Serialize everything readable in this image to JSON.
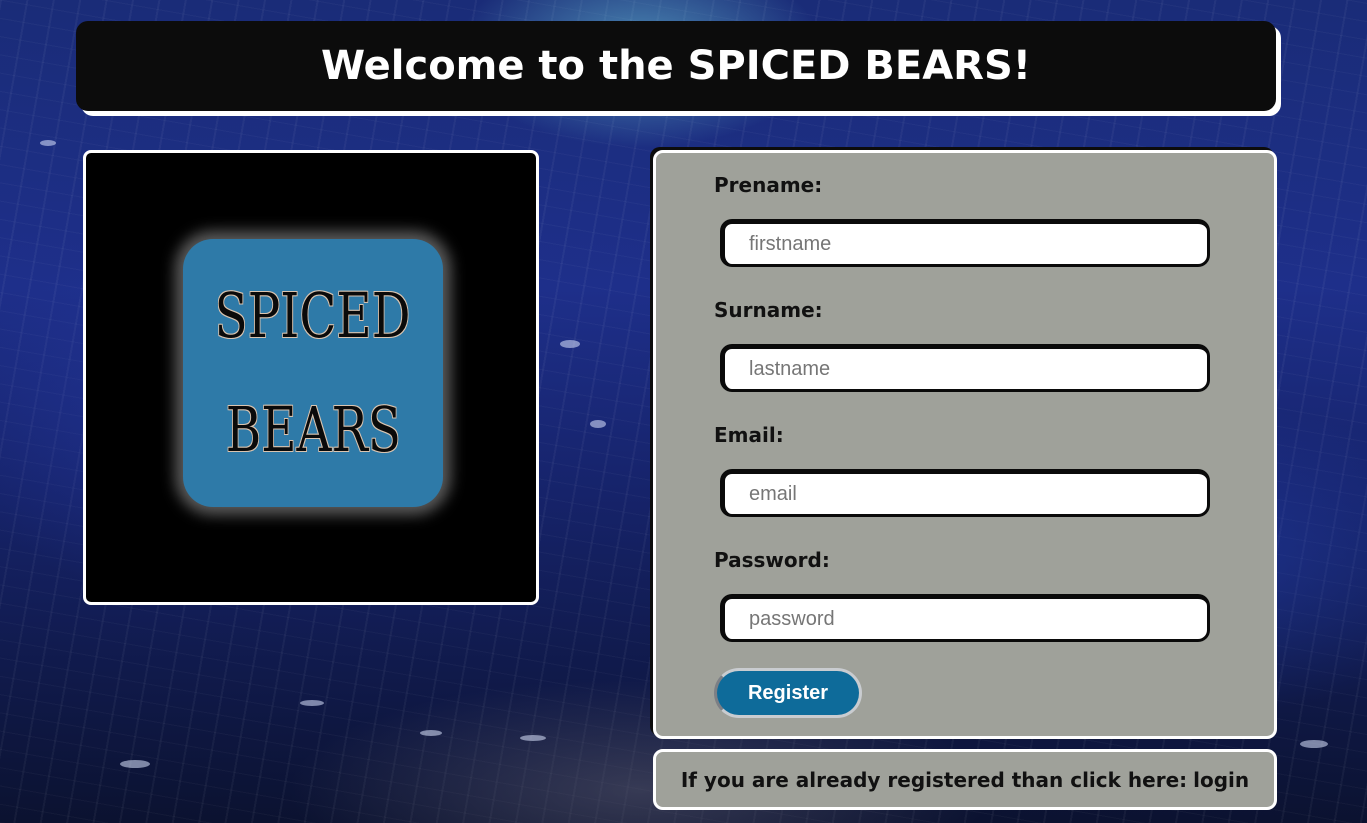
{
  "header": {
    "title": "Welcome to the SPICED BEARS!"
  },
  "logo": {
    "line1": "SPICED",
    "line2": "BEARS"
  },
  "form": {
    "fields": [
      {
        "label": "Prename:",
        "placeholder": "firstname"
      },
      {
        "label": "Surname:",
        "placeholder": "lastname"
      },
      {
        "label": "Email:",
        "placeholder": "email"
      },
      {
        "label": "Password:",
        "placeholder": "password"
      }
    ],
    "register_label": "Register"
  },
  "login": {
    "prompt": "If you are already registered than click here:",
    "link_label": "login"
  },
  "colors": {
    "header_bg": "#0c0c0c",
    "panel_bg": "#9fa19a",
    "logo_tile": "#2e7aa8",
    "register_button": "#0e6b9a"
  }
}
